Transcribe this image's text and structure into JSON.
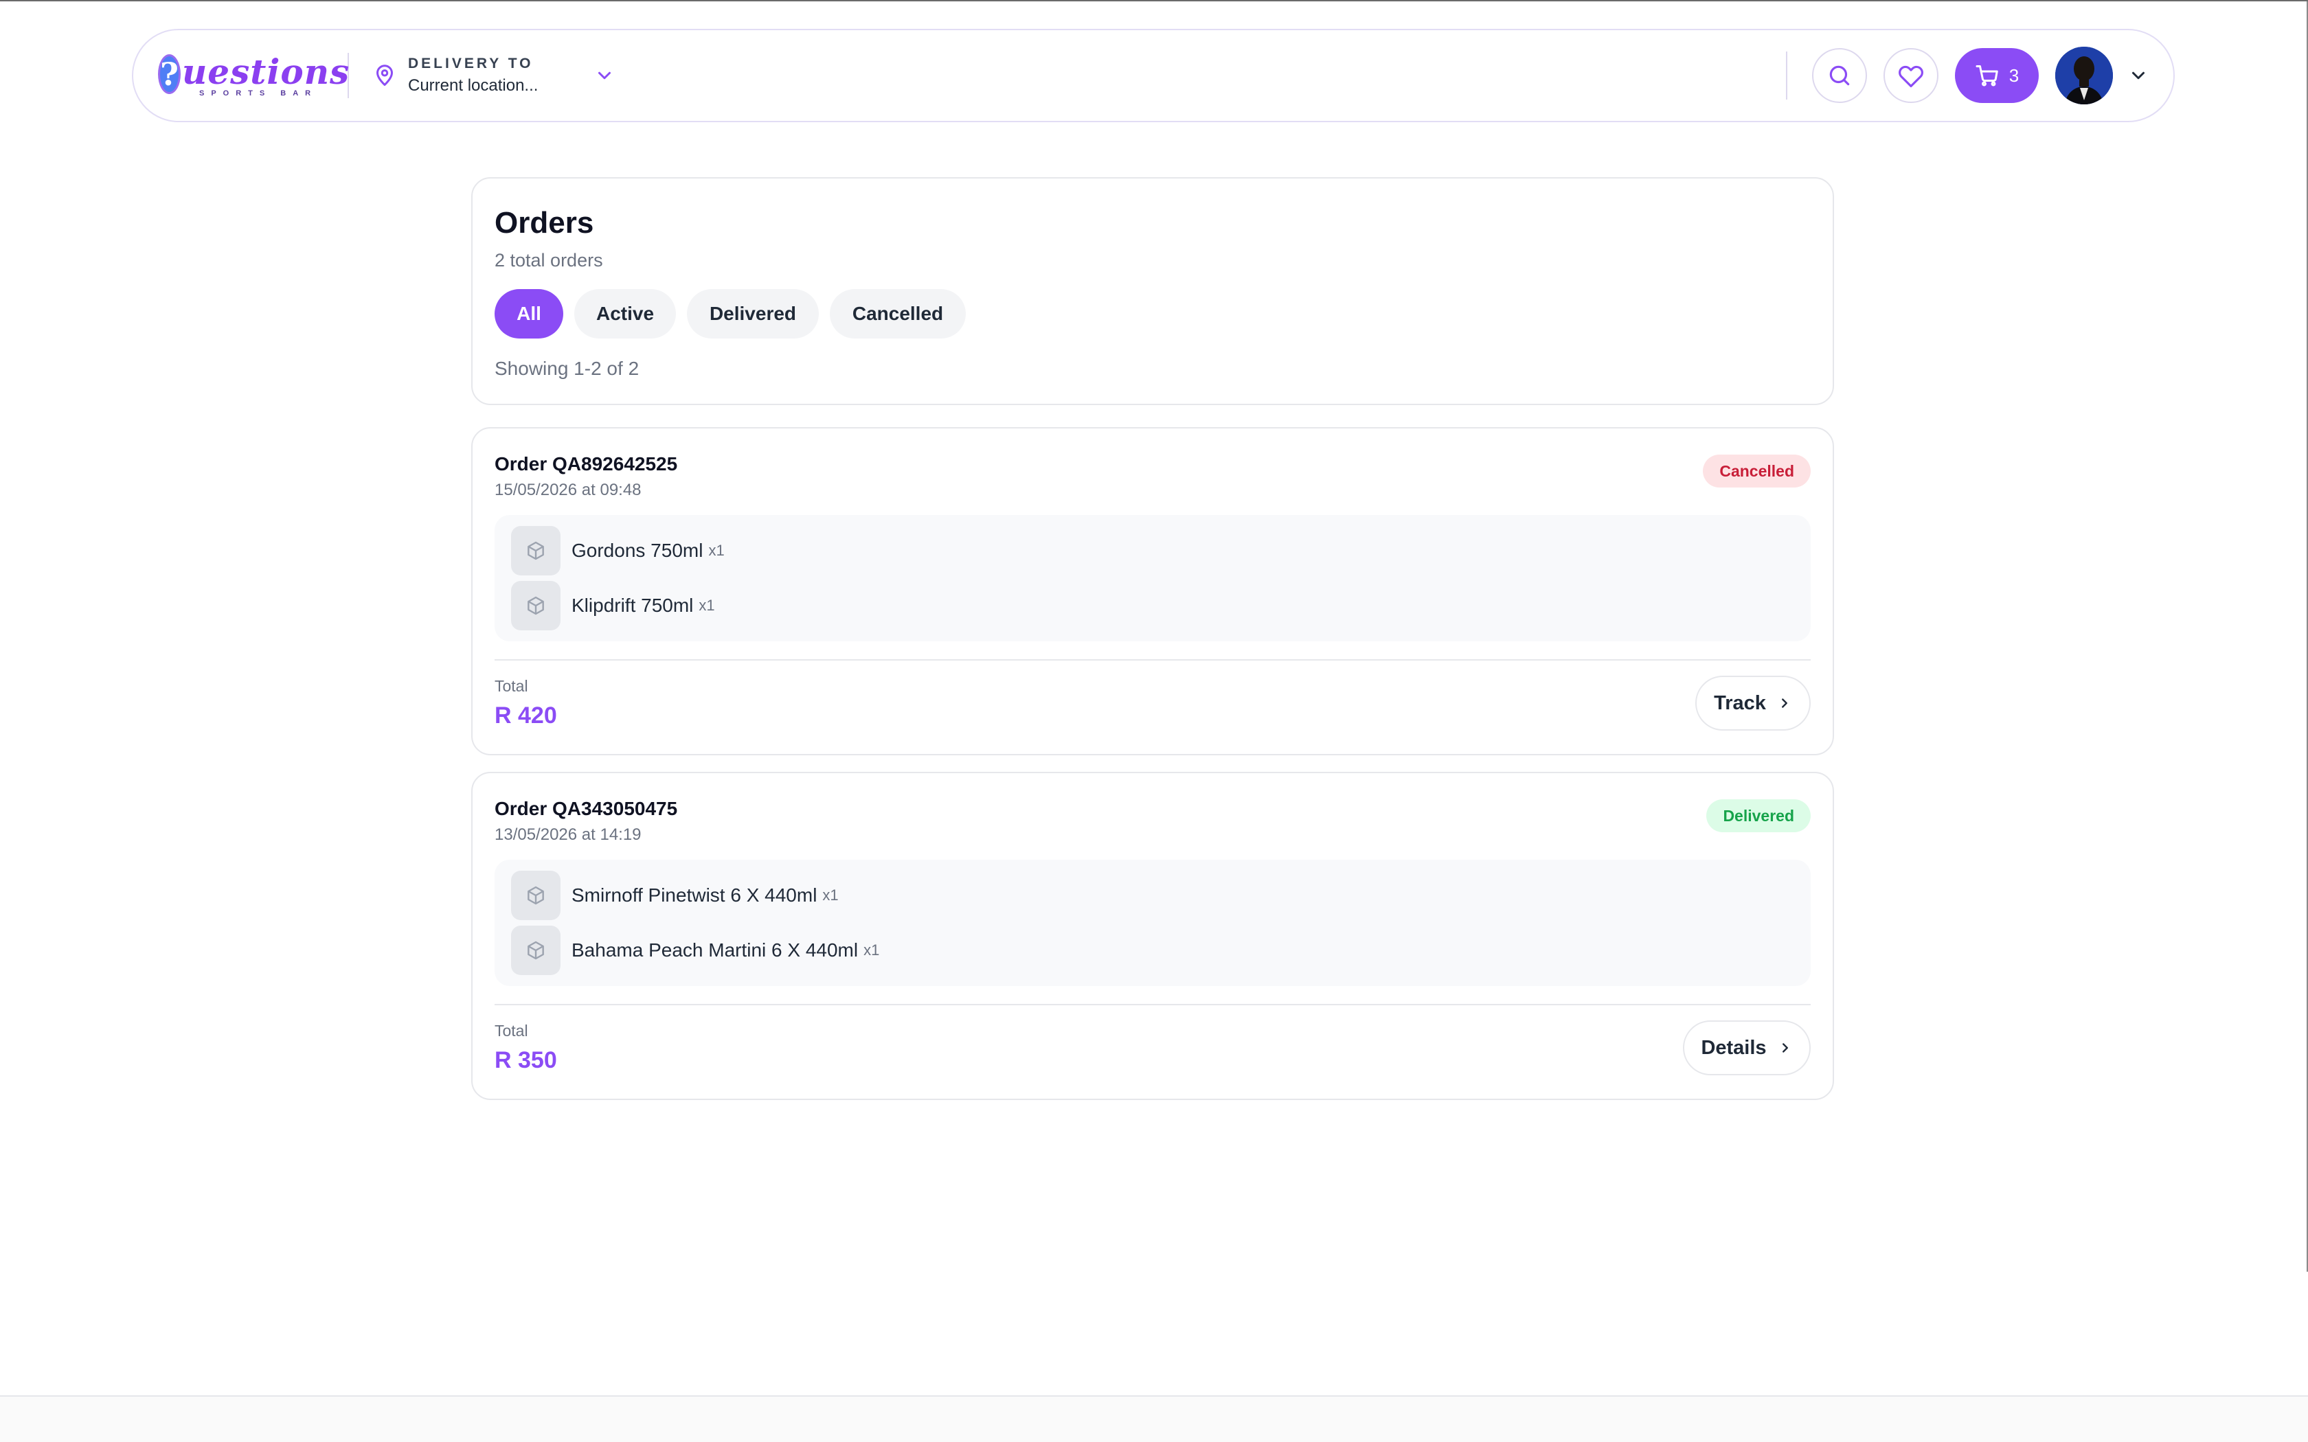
{
  "header": {
    "logo": {
      "mark": "?",
      "word": "uestions",
      "subtitle": "SPORTS BAR"
    },
    "delivery": {
      "label": "DELIVERY TO",
      "value": "Current location..."
    },
    "cart_count": "3",
    "icons": {
      "location": "map-pin-icon",
      "dropdown": "chevron-down-icon",
      "search": "search-icon",
      "wishlist": "heart-icon",
      "cart": "cart-icon",
      "account_dropdown": "chevron-down-icon"
    }
  },
  "orders_summary": {
    "title": "Orders",
    "subtitle": "2 total orders",
    "filters": [
      {
        "label": "All",
        "active": true
      },
      {
        "label": "Active",
        "active": false
      },
      {
        "label": "Delivered",
        "active": false
      },
      {
        "label": "Cancelled",
        "active": false
      }
    ],
    "showing": "Showing 1-2 of 2"
  },
  "orders": [
    {
      "id": "Order QA892642525",
      "date": "15/05/2026 at 09:48",
      "status": "Cancelled",
      "items": [
        {
          "name": "Gordons 750ml",
          "qty": "x1"
        },
        {
          "name": "Klipdrift 750ml",
          "qty": "x1"
        }
      ],
      "total_label": "Total",
      "total": "R 420",
      "action": "Track"
    },
    {
      "id": "Order QA343050475",
      "date": "13/05/2026 at 14:19",
      "status": "Delivered",
      "items": [
        {
          "name": "Smirnoff Pinetwist 6 X 440ml",
          "qty": "x1"
        },
        {
          "name": "Bahama Peach Martini 6 X 440ml",
          "qty": "x1"
        }
      ],
      "total_label": "Total",
      "total": "R 350",
      "action": "Details"
    }
  ],
  "colors": {
    "accent": "#8b4cf5",
    "cancelled_bg": "#fde2e4",
    "cancelled_text": "#c81e38",
    "delivered_bg": "#dcfce7",
    "delivered_text": "#16a34a"
  }
}
